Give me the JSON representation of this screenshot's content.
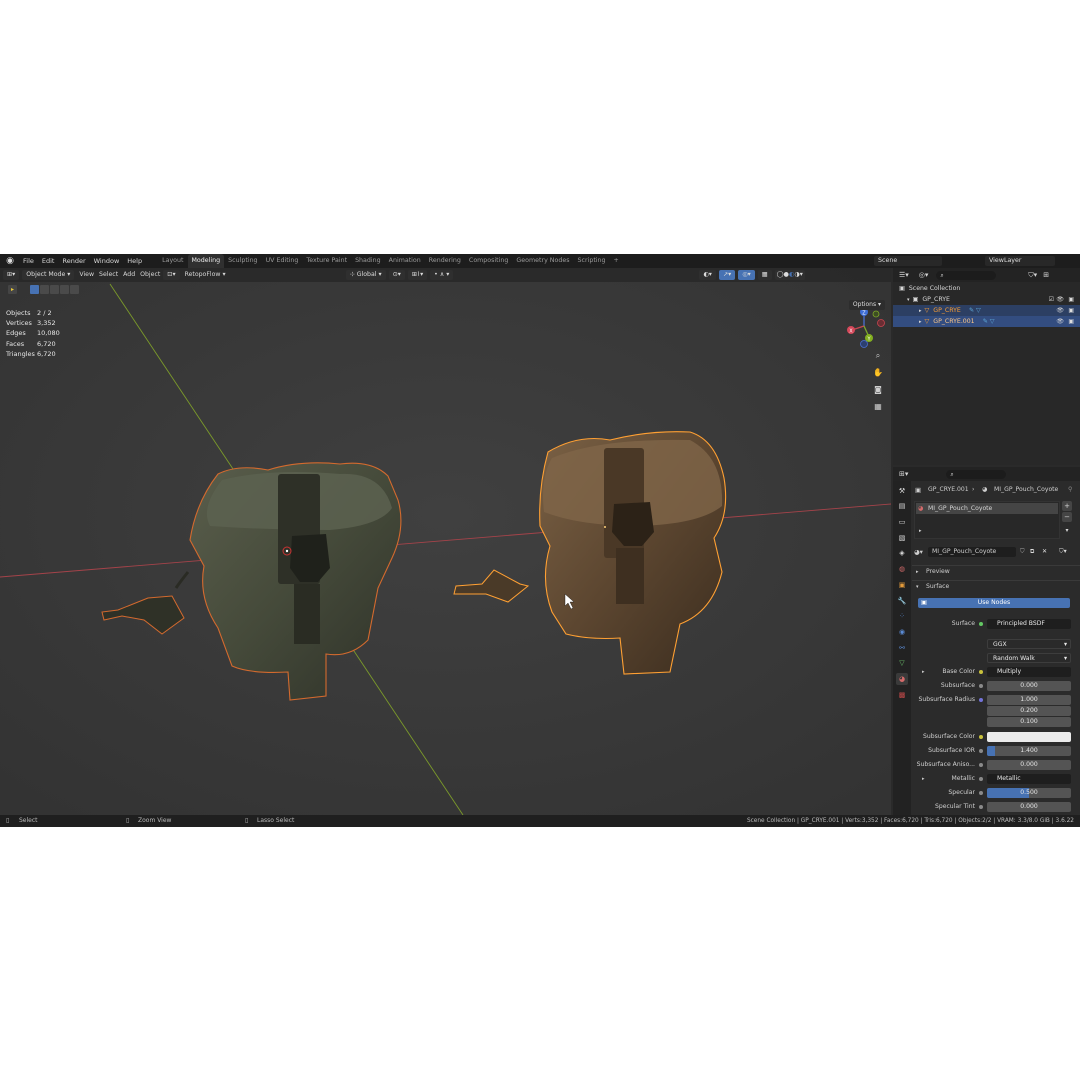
{
  "menu": [
    "File",
    "Edit",
    "Render",
    "Window",
    "Help"
  ],
  "workspaces": [
    "Layout",
    "Modeling",
    "Sculpting",
    "UV Editing",
    "Texture Paint",
    "Shading",
    "Animation",
    "Rendering",
    "Compositing",
    "Geometry Nodes",
    "Scripting",
    "+"
  ],
  "active_workspace": "Modeling",
  "scene_name": "Scene",
  "view_layer": "ViewLayer",
  "viewport_header": {
    "mode": "Object Mode",
    "view": "View",
    "select": "Select",
    "add": "Add",
    "object": "Object",
    "addon": "RetopoFlow",
    "transform_orientation": "Global",
    "options": "Options"
  },
  "stats": [
    {
      "label": "Objects",
      "value": "2 / 2"
    },
    {
      "label": "Vertices",
      "value": "3,352"
    },
    {
      "label": "Edges",
      "value": "10,080"
    },
    {
      "label": "Faces",
      "value": "6,720"
    },
    {
      "label": "Triangles",
      "value": "6,720"
    }
  ],
  "gizmo": {
    "x": "X",
    "y": "Y",
    "z": "Z"
  },
  "outliner": {
    "root": "Scene Collection",
    "collection": "GP_CRYE",
    "objects": [
      "GP_CRYE",
      "GP_CRYE.001"
    ]
  },
  "properties": {
    "breadcrumb_object": "GP_CRYE.001",
    "breadcrumb_material": "MI_GP_Pouch_Coyote",
    "material_slot": "MI_GP_Pouch_Coyote",
    "material_name": "MI_GP_Pouch_Coyote",
    "preview": "Preview",
    "surface_panel": "Surface",
    "use_nodes": "Use Nodes",
    "fields": [
      {
        "label": "Surface",
        "value": "Principled BSDF"
      },
      {
        "label": "",
        "value": "GGX"
      },
      {
        "label": "",
        "value": "Random Walk"
      },
      {
        "label": "Base Color",
        "value": "Multiply"
      },
      {
        "label": "Subsurface",
        "value": "0.000"
      },
      {
        "label": "Subsurface Radius",
        "value": "1.000"
      },
      {
        "label": "",
        "value": "0.200"
      },
      {
        "label": "",
        "value": "0.100"
      },
      {
        "label": "Subsurface Color",
        "value": ""
      },
      {
        "label": "Subsurface IOR",
        "value": "1.400"
      },
      {
        "label": "Subsurface Aniso...",
        "value": "0.000"
      },
      {
        "label": "Metallic",
        "value": "Metallic"
      },
      {
        "label": "Specular",
        "value": "0.500"
      },
      {
        "label": "Specular Tint",
        "value": "0.000"
      }
    ]
  },
  "statusbar": {
    "left1": "Select",
    "left2": "Zoom View",
    "left3": "Lasso Select",
    "right": "Scene Collection | GP_CRYE.001 | Verts:3,352 | Faces:6,720 | Tris:6,720 | Objects:2/2 | VRAM: 3.3/8.0 GiB | 3.6.22"
  },
  "colors": {
    "selection_blue": "#4772b3",
    "active_outline": "#ffa033",
    "selected_outline": "#d46a2e",
    "x_axis": "#a5434a",
    "y_axis": "#7b9a2a"
  },
  "icons": [
    "blender-logo-icon",
    "search-icon",
    "filter-icon",
    "eye-icon",
    "camera-icon",
    "zoom-icon",
    "hand-icon",
    "camera-view-icon",
    "grid-icon",
    "pin-icon"
  ]
}
